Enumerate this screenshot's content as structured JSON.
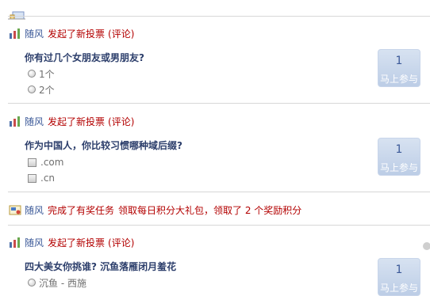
{
  "feed": [
    {
      "user": "随风",
      "action": "发起了新投票",
      "comment": "(评论)",
      "question": "你有过几个女朋友或男朋友?",
      "options": [
        "1个",
        "2个"
      ],
      "vote_count": "1",
      "vote_label": "马上参与"
    },
    {
      "user": "随风",
      "action": "发起了新投票",
      "comment": "(评论)",
      "question": "作为中国人，你比较习惯哪种域后缀?",
      "options": [
        ".com",
        ".cn"
      ],
      "vote_count": "1",
      "vote_label": "马上参与"
    },
    {
      "user": "随风",
      "action": "完成了有奖任务",
      "task": "领取每日积分大礼包",
      "reward": "，领取了 2 个奖励积分"
    },
    {
      "user": "随风",
      "action": "发起了新投票",
      "comment": "(评论)",
      "question": "四大美女你挑谁? 沉鱼落雁闭月羞花",
      "options": [
        "沉鱼 - 西施"
      ],
      "vote_count": "1",
      "vote_label": "马上参与"
    }
  ],
  "colors": {
    "user": "#3b5998",
    "action": "#b30000",
    "question": "#2c3e6b",
    "divider": "#d7d7d7",
    "vote_box": "#c9d7ea"
  },
  "icons": [
    "feed-top-icon",
    "poll-icon",
    "task-icon"
  ]
}
